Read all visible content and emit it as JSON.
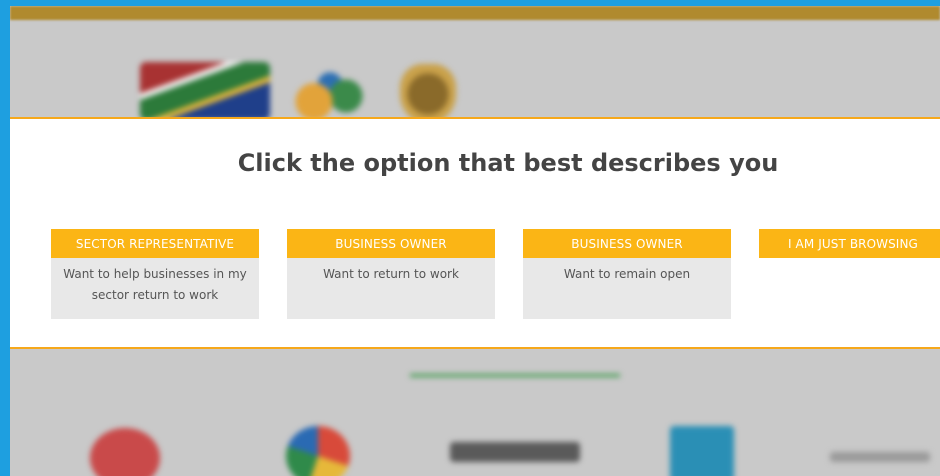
{
  "modal": {
    "title": "Click the option that best describes you",
    "options": [
      {
        "header": "SECTOR REPRESENTATIVE",
        "body_line1": "Want to help businesses in my",
        "body_line2": "sector return to work"
      },
      {
        "header": "BUSINESS OWNER",
        "body_line1": "Want to return to work",
        "body_line2": ""
      },
      {
        "header": "BUSINESS OWNER",
        "body_line1": "Want to remain open",
        "body_line2": ""
      },
      {
        "header": "I AM JUST BROWSING",
        "body_line1": "",
        "body_line2": ""
      }
    ]
  },
  "colors": {
    "frame": "#1e9fe0",
    "accent": "#fbb515",
    "option_body": "#e8e8e8",
    "title_text": "#444444"
  }
}
